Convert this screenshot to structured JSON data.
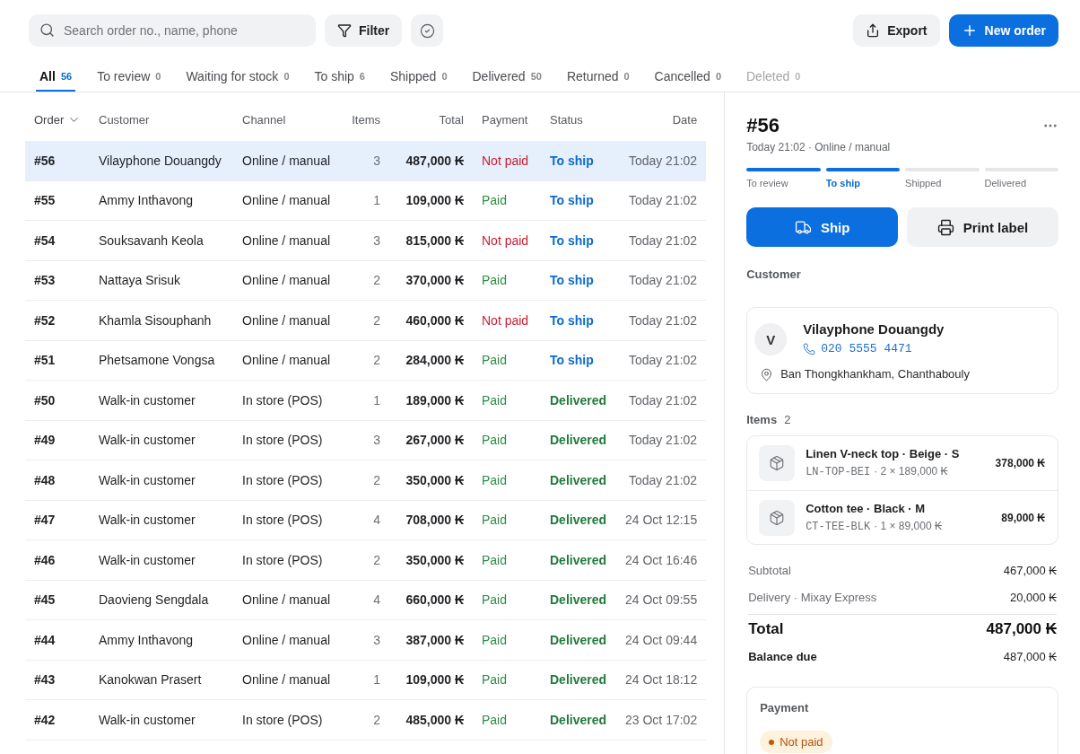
{
  "toolbar": {
    "search": {
      "placeholder": "Search order no., name, phone"
    },
    "filter_button": "Filter",
    "export_button": "Export",
    "new_order_button": "New order"
  },
  "tabs": [
    {
      "label": "All",
      "count": "56",
      "selected": true,
      "disabled": false
    },
    {
      "label": "To review",
      "count": "0",
      "selected": false,
      "disabled": false
    },
    {
      "label": "Waiting for stock",
      "count": "0",
      "selected": false,
      "disabled": false
    },
    {
      "label": "To ship",
      "count": "6",
      "selected": false,
      "disabled": false
    },
    {
      "label": "Shipped",
      "count": "0",
      "selected": false,
      "disabled": false
    },
    {
      "label": "Delivered",
      "count": "50",
      "selected": false,
      "disabled": false
    },
    {
      "label": "Returned",
      "count": "0",
      "selected": false,
      "disabled": false
    },
    {
      "label": "Cancelled",
      "count": "0",
      "selected": false,
      "disabled": false
    },
    {
      "label": "Deleted",
      "count": "0",
      "selected": false,
      "disabled": true
    }
  ],
  "table": {
    "columns": [
      {
        "label": "Order",
        "sorted": true
      },
      {
        "label": "Customer",
        "sorted": false
      },
      {
        "label": "Channel",
        "sorted": false
      },
      {
        "label": "Items",
        "sorted": false
      },
      {
        "label": "Total",
        "sorted": false
      },
      {
        "label": "Payment",
        "sorted": false
      },
      {
        "label": "Status",
        "sorted": false
      },
      {
        "label": "Date",
        "sorted": false
      }
    ],
    "rows": [
      {
        "order": "#56",
        "customer": "Vilayphone Douangdy",
        "channel": "Online / manual",
        "items": "3",
        "total": "487,000 ₭",
        "payment": {
          "text": "Not paid",
          "kind": "unpaid"
        },
        "status": {
          "text": "To ship",
          "kind": "to_ship"
        },
        "date": "Today 21:02",
        "selected": true
      },
      {
        "order": "#55",
        "customer": "Ammy Inthavong",
        "channel": "Online / manual",
        "items": "1",
        "total": "109,000 ₭",
        "payment": {
          "text": "Paid",
          "kind": "paid"
        },
        "status": {
          "text": "To ship",
          "kind": "to_ship"
        },
        "date": "Today 21:02",
        "selected": false
      },
      {
        "order": "#54",
        "customer": "Souksavanh Keola",
        "channel": "Online / manual",
        "items": "3",
        "total": "815,000 ₭",
        "payment": {
          "text": "Not paid",
          "kind": "unpaid"
        },
        "status": {
          "text": "To ship",
          "kind": "to_ship"
        },
        "date": "Today 21:02",
        "selected": false
      },
      {
        "order": "#53",
        "customer": "Nattaya Srisuk",
        "channel": "Online / manual",
        "items": "2",
        "total": "370,000 ₭",
        "payment": {
          "text": "Paid",
          "kind": "paid"
        },
        "status": {
          "text": "To ship",
          "kind": "to_ship"
        },
        "date": "Today 21:02",
        "selected": false
      },
      {
        "order": "#52",
        "customer": "Khamla Sisouphanh",
        "channel": "Online / manual",
        "items": "2",
        "total": "460,000 ₭",
        "payment": {
          "text": "Not paid",
          "kind": "unpaid"
        },
        "status": {
          "text": "To ship",
          "kind": "to_ship"
        },
        "date": "Today 21:02",
        "selected": false
      },
      {
        "order": "#51",
        "customer": "Phetsamone Vongsa",
        "channel": "Online / manual",
        "items": "2",
        "total": "284,000 ₭",
        "payment": {
          "text": "Paid",
          "kind": "paid"
        },
        "status": {
          "text": "To ship",
          "kind": "to_ship"
        },
        "date": "Today 21:02",
        "selected": false
      },
      {
        "order": "#50",
        "customer": "Walk-in customer",
        "channel": "In store (POS)",
        "items": "1",
        "total": "189,000 ₭",
        "payment": {
          "text": "Paid",
          "kind": "paid"
        },
        "status": {
          "text": "Delivered",
          "kind": "delivered"
        },
        "date": "Today 21:02",
        "selected": false
      },
      {
        "order": "#49",
        "customer": "Walk-in customer",
        "channel": "In store (POS)",
        "items": "3",
        "total": "267,000 ₭",
        "payment": {
          "text": "Paid",
          "kind": "paid"
        },
        "status": {
          "text": "Delivered",
          "kind": "delivered"
        },
        "date": "Today 21:02",
        "selected": false
      },
      {
        "order": "#48",
        "customer": "Walk-in customer",
        "channel": "In store (POS)",
        "items": "2",
        "total": "350,000 ₭",
        "payment": {
          "text": "Paid",
          "kind": "paid"
        },
        "status": {
          "text": "Delivered",
          "kind": "delivered"
        },
        "date": "Today 21:02",
        "selected": false
      },
      {
        "order": "#47",
        "customer": "Walk-in customer",
        "channel": "In store (POS)",
        "items": "4",
        "total": "708,000 ₭",
        "payment": {
          "text": "Paid",
          "kind": "paid"
        },
        "status": {
          "text": "Delivered",
          "kind": "delivered"
        },
        "date": "24 Oct 12:15",
        "selected": false
      },
      {
        "order": "#46",
        "customer": "Walk-in customer",
        "channel": "In store (POS)",
        "items": "2",
        "total": "350,000 ₭",
        "payment": {
          "text": "Paid",
          "kind": "paid"
        },
        "status": {
          "text": "Delivered",
          "kind": "delivered"
        },
        "date": "24 Oct 16:46",
        "selected": false
      },
      {
        "order": "#45",
        "customer": "Daovieng Sengdala",
        "channel": "Online / manual",
        "items": "4",
        "total": "660,000 ₭",
        "payment": {
          "text": "Paid",
          "kind": "paid"
        },
        "status": {
          "text": "Delivered",
          "kind": "delivered"
        },
        "date": "24 Oct 09:55",
        "selected": false
      },
      {
        "order": "#44",
        "customer": "Ammy Inthavong",
        "channel": "Online / manual",
        "items": "3",
        "total": "387,000 ₭",
        "payment": {
          "text": "Paid",
          "kind": "paid"
        },
        "status": {
          "text": "Delivered",
          "kind": "delivered"
        },
        "date": "24 Oct 09:44",
        "selected": false
      },
      {
        "order": "#43",
        "customer": "Kanokwan Prasert",
        "channel": "Online / manual",
        "items": "1",
        "total": "109,000 ₭",
        "payment": {
          "text": "Paid",
          "kind": "paid"
        },
        "status": {
          "text": "Delivered",
          "kind": "delivered"
        },
        "date": "24 Oct 18:12",
        "selected": false
      },
      {
        "order": "#42",
        "customer": "Walk-in customer",
        "channel": "In store (POS)",
        "items": "2",
        "total": "485,000 ₭",
        "payment": {
          "text": "Paid",
          "kind": "paid"
        },
        "status": {
          "text": "Delivered",
          "kind": "delivered"
        },
        "date": "23 Oct 17:02",
        "selected": false
      }
    ]
  },
  "detail": {
    "title": "#56",
    "subtitle": "Today 21:02 · Online / manual",
    "steps": [
      {
        "label": "To review",
        "done": true,
        "current": false
      },
      {
        "label": "To ship",
        "done": true,
        "current": true
      },
      {
        "label": "Shipped",
        "done": false,
        "current": false
      },
      {
        "label": "Delivered",
        "done": false,
        "current": false
      }
    ],
    "actions": [
      {
        "label": "Ship",
        "kind": "primary"
      },
      {
        "label": "Print label",
        "kind": "secondary"
      }
    ],
    "customer_label": "Customer",
    "customer": {
      "initial": "V",
      "name": "Vilayphone Douangdy",
      "phone": "020 5555 4471",
      "address": "Ban Thongkhankham, Chanthabouly"
    },
    "items_label": "Items",
    "items_count": "2",
    "items": [
      {
        "name": "Linen V-neck top · Beige · S",
        "sku": "LN-TOP-BEI",
        "quantity_price": "· 2 × 189,000 ₭",
        "amount": "378,000 ₭"
      },
      {
        "name": "Cotton tee · Black · M",
        "sku": "CT-TEE-BLK",
        "quantity_price": "· 1 × 89,000 ₭",
        "amount": "89,000 ₭"
      }
    ],
    "summary": [
      {
        "label": "Subtotal",
        "value": "467,000 ₭",
        "kind": "line"
      },
      {
        "label": "Delivery · Mixay Express",
        "value": "20,000 ₭",
        "kind": "line"
      },
      {
        "label": "Total",
        "value": "487,000 ₭",
        "kind": "total"
      },
      {
        "label": "Balance due",
        "value": "487,000 ₭",
        "kind": "due"
      }
    ],
    "payment": {
      "title": "Payment",
      "status": {
        "text": "Not paid",
        "kind": "unpaid"
      }
    }
  }
}
